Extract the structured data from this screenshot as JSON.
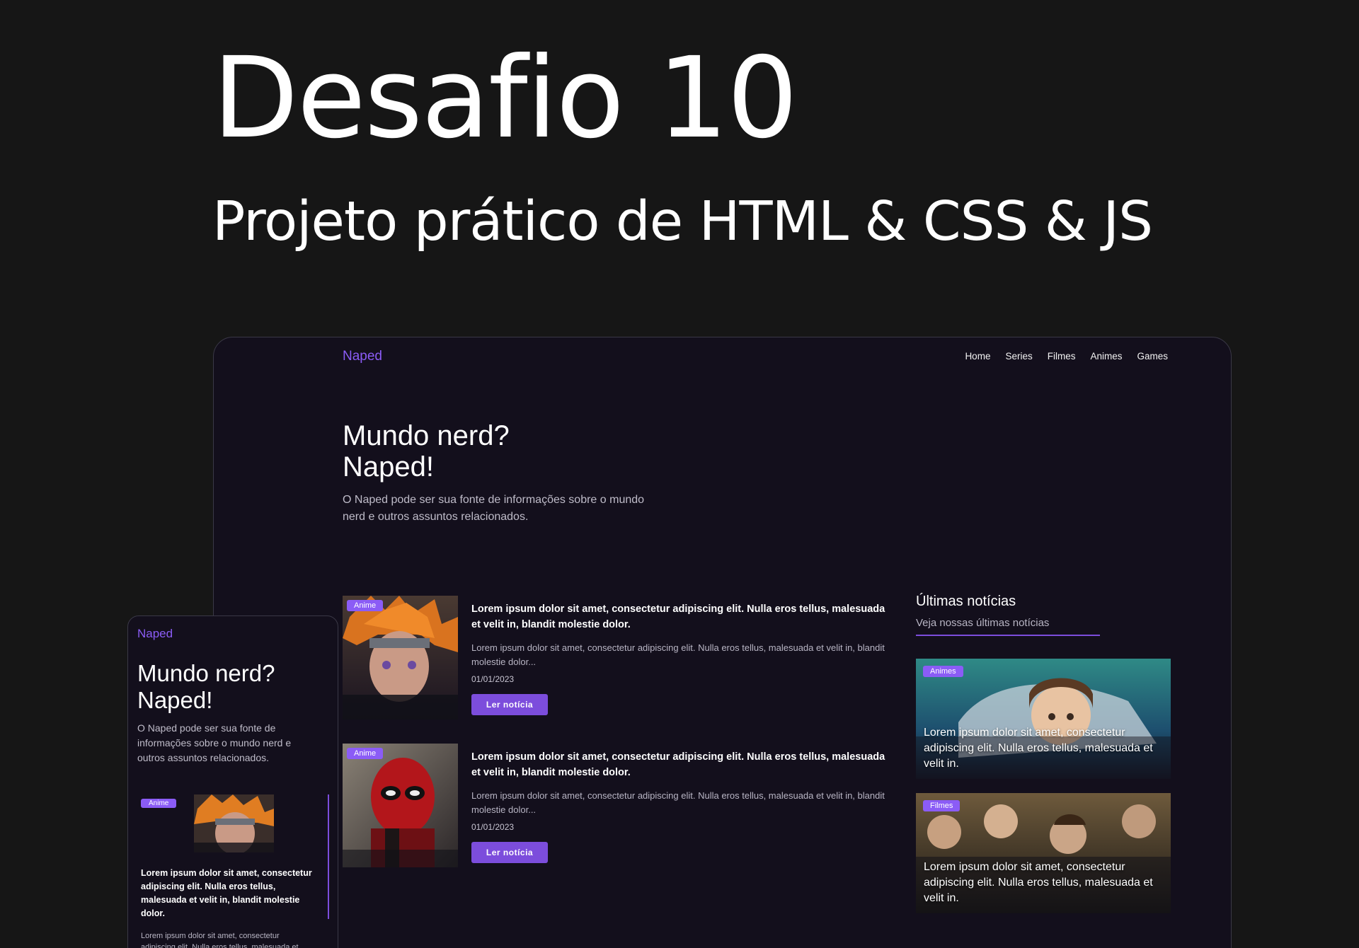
{
  "banner": {
    "title": "Desafio 10",
    "subtitle": "Projeto prático de HTML & CSS & JS"
  },
  "desktop": {
    "logo": "Naped",
    "nav": [
      "Home",
      "Series",
      "Filmes",
      "Animes",
      "Games"
    ],
    "hero": {
      "line1": "Mundo nerd?",
      "line2": "Naped!",
      "text": "O Naped pode ser sua fonte de informações sobre o mundo nerd e outros assuntos relacionados."
    },
    "articles": [
      {
        "badge": "Anime",
        "title": "Lorem ipsum dolor sit amet, consectetur adipiscing elit. Nulla eros tellus, malesuada et velit in, blandit molestie dolor.",
        "excerpt": "Lorem ipsum dolor sit amet, consectetur adipiscing elit. Nulla eros tellus, malesuada et velit in, blandit molestie dolor...",
        "date": "01/01/2023",
        "button": "Ler notícia"
      },
      {
        "badge": "Anime",
        "title": "Lorem ipsum dolor sit amet, consectetur adipiscing elit. Nulla eros tellus, malesuada et velit in, blandit molestie dolor.",
        "excerpt": "Lorem ipsum dolor sit amet, consectetur adipiscing elit. Nulla eros tellus, malesuada et velit in, blandit molestie dolor...",
        "date": "01/01/2023",
        "button": "Ler notícia"
      }
    ],
    "sidebar": {
      "title": "Últimas notícias",
      "subtitle": "Veja nossas últimas notícias",
      "cards": [
        {
          "badge": "Animes",
          "text": "Lorem ipsum dolor sit amet, consectetur adipiscing elit. Nulla eros tellus, malesuada et velit in."
        },
        {
          "badge": "Filmes",
          "text": "Lorem ipsum dolor sit amet, consectetur adipiscing elit. Nulla eros tellus, malesuada et velit in."
        }
      ]
    }
  },
  "mobile": {
    "logo": "Naped",
    "hero": {
      "line1": "Mundo nerd?",
      "line2": "Naped!",
      "text": "O Naped pode ser sua fonte de informações sobre o mundo nerd e outros assuntos relacionados."
    },
    "article": {
      "badge": "Anime",
      "title": "Lorem ipsum dolor sit amet, consectetur adipiscing elit. Nulla eros tellus, malesuada et velit in, blandit molestie dolor.",
      "excerpt": "Lorem ipsum dolor sit amet, consectetur adipiscing elit. Nulla eros tellus, malesuada et"
    }
  },
  "colors": {
    "page_bg": "#161616",
    "app_bg": "#130f1c",
    "accent": "#8b5cf6",
    "button": "#7c4ddc"
  }
}
